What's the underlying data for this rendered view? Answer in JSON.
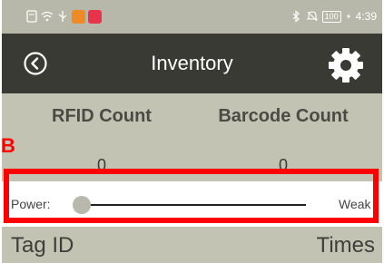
{
  "status_bar": {
    "time": "4:39",
    "battery": "100",
    "icons": [
      "notification-icon",
      "wifi-icon",
      "usb-icon",
      "app-orange-icon",
      "app-red-icon",
      "bluetooth-icon",
      "mute-icon",
      "charging-icon"
    ]
  },
  "header": {
    "title": "Inventory",
    "back_icon": "back-circle-icon",
    "settings_icon": "gear-icon"
  },
  "counts": {
    "rfid_label": "RFID Count",
    "rfid_value": "0",
    "barcode_label": "Barcode Count",
    "barcode_value": "0"
  },
  "power": {
    "label": "Power:",
    "level_text": "Weak",
    "slider_fraction": 0.0
  },
  "tag_list": {
    "columns": [
      "Tag ID",
      "Times"
    ]
  },
  "annotation": {
    "letter": "B",
    "color": "#ff0000"
  },
  "colors": {
    "header_bg": "#3a3a35",
    "panel_bg": "#c2c3b3",
    "status_bg": "#b7b8a9"
  }
}
